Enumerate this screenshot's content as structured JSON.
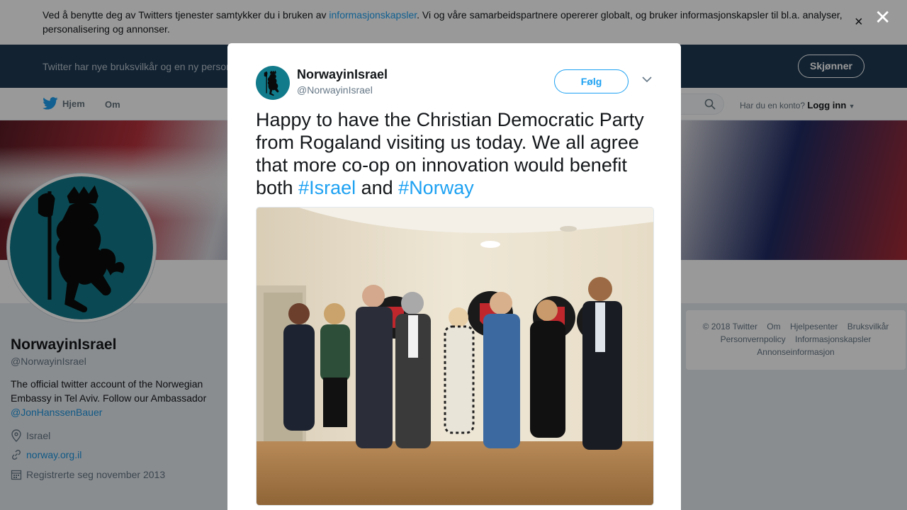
{
  "cookie_banner": {
    "text_before": "Ved å benytte deg av Twitters tjenester samtykker du i bruken av ",
    "link": "informasjonskapsler",
    "text_after": ". Vi og våre samarbeidspartnere opererer globalt, og bruker informasjonskapsler til bl.a. analyser, personalisering og annonser.",
    "close": "×"
  },
  "tos_bar": {
    "text": "Twitter har nye bruksvilkår og en ny personvernpolicy",
    "button": "Skjønner"
  },
  "nav": {
    "home": "Hjem",
    "about": "Om",
    "login_prompt": "Har du en konto?",
    "login_link": "Logg inn"
  },
  "profile": {
    "name": "NorwayinIsrael",
    "handle": "@NorwayinIsrael",
    "bio": "The official twitter account of the Norwegian Embassy in Tel Aviv. Follow our Ambassador ",
    "bio_link": "@JonHanssenBauer",
    "location": "Israel",
    "website": "norway.org.il",
    "joined": "Registrerte seg november 2013"
  },
  "footer": {
    "links": [
      "© 2018 Twitter",
      "Om",
      "Hjelpesenter",
      "Bruksvilkår",
      "Personvernpolicy",
      "Informasjonskapsler",
      "Annonseinformasjon"
    ]
  },
  "overlay": {
    "close": "✕"
  },
  "tweet": {
    "name": "NorwayinIsrael",
    "handle": "@NorwayinIsrael",
    "follow": "Følg",
    "text_main": "Happy to have the Christian Democratic Party from Rogaland visiting us today. We all agree that more co-op on innovation would benefit both ",
    "hashtag1": "#Israel",
    "text_mid": " and ",
    "hashtag2": "#Norway"
  },
  "colors": {
    "accent": "#1da1f2",
    "navy": "#1e3a52",
    "avatar_bg": "#117a8b"
  },
  "icons": [
    "twitter-bird-icon",
    "search-icon",
    "caret-down-icon",
    "location-pin-icon",
    "link-icon",
    "calendar-icon",
    "close-icon",
    "chevron-down-icon"
  ]
}
